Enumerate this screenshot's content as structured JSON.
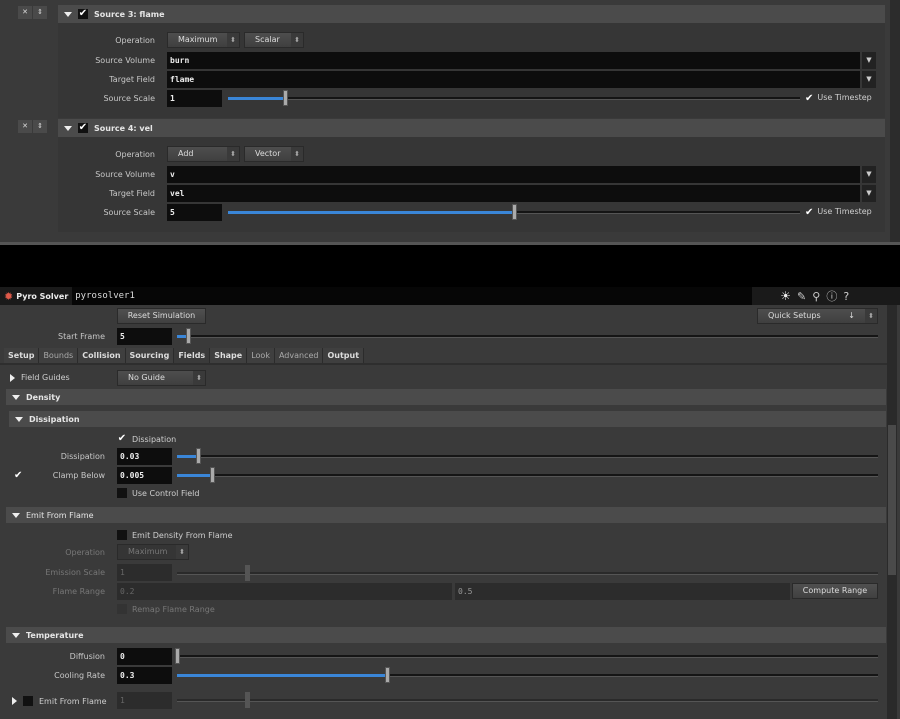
{
  "sources": [
    {
      "title": "Source 3:  flame",
      "operation": "Maximum",
      "type": "Scalar",
      "source_volume": "burn",
      "target_field": "flame",
      "source_scale": "1",
      "scale_fraction": 0.1,
      "use_timestep": "Use Timestep"
    },
    {
      "title": "Source 4:  vel",
      "operation": "Add",
      "type": "Vector",
      "source_volume": "v",
      "target_field": "vel",
      "source_scale": "5",
      "scale_fraction": 0.5,
      "use_timestep": "Use Timestep"
    }
  ],
  "labels": {
    "operation": "Operation",
    "source_volume": "Source Volume",
    "target_field": "Target Field",
    "source_scale": "Source Scale"
  },
  "solver": {
    "type": "Pyro Solver",
    "name": "pyrosolver1",
    "reset": "Reset Simulation",
    "quick_setups": "Quick Setups",
    "start_frame_label": "Start Frame",
    "start_frame": "5",
    "start_fraction": 0.015,
    "tabs": [
      "Setup",
      "Bounds",
      "Collision",
      "Sourcing",
      "Fields",
      "Shape",
      "Look",
      "Advanced",
      "Output"
    ],
    "field_guides": "Field Guides",
    "field_guide_value": "No Guide",
    "density": "Density",
    "dissipation_section": "Dissipation",
    "dissipation_toggle": "Dissipation",
    "dissipation_label": "Dissipation",
    "dissipation": "0.03",
    "dissipation_fraction": 0.03,
    "clamp_label": "Clamp Below",
    "clamp": "0.005",
    "clamp_fraction": 0.05,
    "use_control_field": "Use Control Field",
    "emit_section": "Emit From Flame",
    "emit_density": "Emit Density From Flame",
    "operation_label": "Operation",
    "operation": "Maximum",
    "emission_scale_label": "Emission Scale",
    "emission_scale": "1",
    "emission_fraction": 0.1,
    "flame_range_label": "Flame Range",
    "flame_min": "0.2",
    "flame_max": "0.5",
    "compute_range": "Compute Range",
    "remap": "Remap Flame Range",
    "temperature": "Temperature",
    "diffusion_label": "Diffusion",
    "diffusion": "0",
    "diffusion_fraction": 0,
    "cooling_label": "Cooling Rate",
    "cooling": "0.3",
    "cooling_fraction": 0.3,
    "emit_from_flame": "Emit From Flame",
    "emit_from_flame_value": "1"
  }
}
